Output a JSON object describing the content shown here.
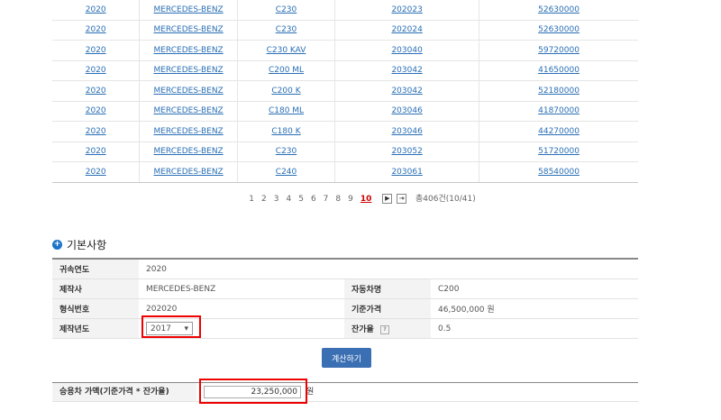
{
  "results": {
    "rows": [
      {
        "year": "2020",
        "maker": "MERCEDES-BENZ",
        "model": "C230",
        "code": "202023",
        "price": "52630000"
      },
      {
        "year": "2020",
        "maker": "MERCEDES-BENZ",
        "model": "C230",
        "code": "202024",
        "price": "52630000"
      },
      {
        "year": "2020",
        "maker": "MERCEDES-BENZ",
        "model": "C230 KAV",
        "code": "203040",
        "price": "59720000"
      },
      {
        "year": "2020",
        "maker": "MERCEDES-BENZ",
        "model": "C200 ML",
        "code": "203042",
        "price": "41650000"
      },
      {
        "year": "2020",
        "maker": "MERCEDES-BENZ",
        "model": "C200 K",
        "code": "203042",
        "price": "52180000"
      },
      {
        "year": "2020",
        "maker": "MERCEDES-BENZ",
        "model": "C180 ML",
        "code": "203046",
        "price": "41870000"
      },
      {
        "year": "2020",
        "maker": "MERCEDES-BENZ",
        "model": "C180 K",
        "code": "203046",
        "price": "44270000"
      },
      {
        "year": "2020",
        "maker": "MERCEDES-BENZ",
        "model": "C230",
        "code": "203052",
        "price": "51720000"
      },
      {
        "year": "2020",
        "maker": "MERCEDES-BENZ",
        "model": "C240",
        "code": "203061",
        "price": "58540000"
      }
    ]
  },
  "pager": {
    "pages": [
      "1",
      "2",
      "3",
      "4",
      "5",
      "6",
      "7",
      "8",
      "9",
      "10"
    ],
    "current": "10",
    "next": "▶",
    "last": "⇥",
    "total": "총406건(10/41)"
  },
  "section": {
    "title": "기본사항"
  },
  "info": {
    "year_label": "귀속연도",
    "year_value": "2020",
    "maker_label": "제작사",
    "maker_value": "MERCEDES-BENZ",
    "carname_label": "자동차명",
    "carname_value": "C200",
    "typenum_label": "형식번호",
    "typenum_value": "202020",
    "baseprice_label": "기준가격",
    "baseprice_value": "46,500,000 원",
    "mfgyear_label": "제작년도",
    "mfgyear_value": "2017",
    "residual_label": "잔가율",
    "residual_help": "?",
    "residual_value": "0.5"
  },
  "calc_button": "계산하기",
  "result": {
    "label": "승용차 가액(기준가격 * 잔가율)",
    "value": "23,250,000",
    "unit": "원"
  },
  "colors": {
    "link": "#2a6fb5",
    "highlight": "#e00000",
    "button": "#3a6fb3"
  }
}
